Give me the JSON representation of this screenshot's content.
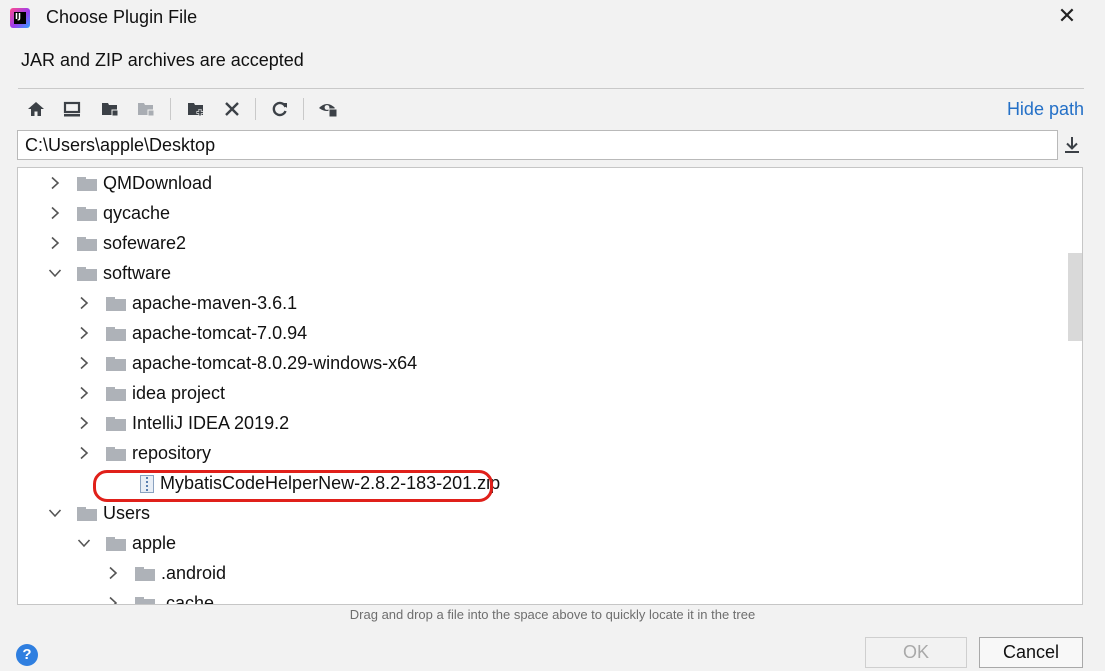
{
  "window": {
    "title": "Choose Plugin File",
    "close_glyph": "✕"
  },
  "subtitle": "JAR and ZIP archives are accepted",
  "toolbar": {
    "icons": [
      "home-icon",
      "desktop-icon",
      "project-folder-icon",
      "module-folder-icon",
      "new-folder-icon",
      "delete-icon",
      "refresh-icon",
      "show-hidden-icon"
    ],
    "hide_path_label": "Hide path"
  },
  "path": {
    "value": "C:\\Users\\apple\\Desktop"
  },
  "tree": {
    "rows": [
      {
        "label": "QMDownload",
        "level": 1,
        "expanded": false,
        "type": "folder"
      },
      {
        "label": "qycache",
        "level": 1,
        "expanded": false,
        "type": "folder"
      },
      {
        "label": "sofeware2",
        "level": 1,
        "expanded": false,
        "type": "folder"
      },
      {
        "label": "software",
        "level": 1,
        "expanded": true,
        "type": "folder"
      },
      {
        "label": "apache-maven-3.6.1",
        "level": 2,
        "expanded": false,
        "type": "folder"
      },
      {
        "label": "apache-tomcat-7.0.94",
        "level": 2,
        "expanded": false,
        "type": "folder"
      },
      {
        "label": "apache-tomcat-8.0.29-windows-x64",
        "level": 2,
        "expanded": false,
        "type": "folder"
      },
      {
        "label": "idea project",
        "level": 2,
        "expanded": false,
        "type": "folder"
      },
      {
        "label": "IntelliJ IDEA 2019.2",
        "level": 2,
        "expanded": false,
        "type": "folder"
      },
      {
        "label": "repository",
        "level": 2,
        "expanded": false,
        "type": "folder"
      },
      {
        "label": "MybatisCodeHelperNew-2.8.2-183-201.zip",
        "level": 2,
        "expanded": null,
        "type": "zip",
        "highlighted": true
      },
      {
        "label": "Users",
        "level": 1,
        "expanded": true,
        "type": "folder"
      },
      {
        "label": "apple",
        "level": 2,
        "expanded": true,
        "type": "folder"
      },
      {
        "label": ".android",
        "level": 3,
        "expanded": false,
        "type": "folder"
      },
      {
        "label": ".cache",
        "level": 3,
        "expanded": false,
        "type": "folder"
      }
    ]
  },
  "hint": "Drag and drop a file into the space above to quickly locate it in the tree",
  "footer": {
    "help_glyph": "?",
    "ok_label": "OK",
    "cancel_label": "Cancel"
  },
  "colors": {
    "accent_link": "#2470c7",
    "highlight_border": "#e0201a",
    "help_button": "#2f7fe0"
  }
}
